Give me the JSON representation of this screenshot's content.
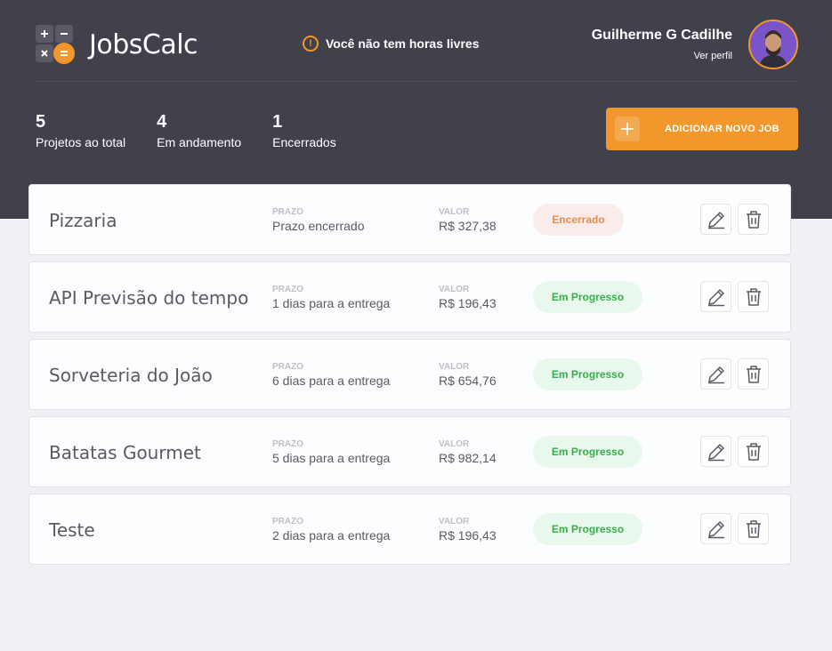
{
  "app": {
    "name": "JobsCalc"
  },
  "alert": {
    "text": "Você não tem horas livres"
  },
  "profile": {
    "name": "Guilherme G Cadilhe",
    "link": "Ver perfil"
  },
  "stats": [
    {
      "number": "5",
      "label": "Projetos ao total"
    },
    {
      "number": "4",
      "label": "Em andamento"
    },
    {
      "number": "1",
      "label": "Encerrados"
    }
  ],
  "add_button": {
    "label": "ADICIONAR NOVO JOB"
  },
  "columns": {
    "deadline_label": "PRAZO",
    "value_label": "VALOR"
  },
  "colors": {
    "accent": "#F1972C",
    "header": "#41414C",
    "done_bg": "#FAECEB",
    "done_fg": "#EB8C4A",
    "progress_bg": "#E8F8EC",
    "progress_fg": "#36B04A"
  },
  "jobs": [
    {
      "name": "Pizzaria",
      "deadline": "Prazo encerrado",
      "value": "R$ 327,38",
      "status": "Encerrado",
      "status_type": "done"
    },
    {
      "name": "API Previsão do tempo",
      "deadline": "1 dias para a entrega",
      "value": "R$ 196,43",
      "status": "Em Progresso",
      "status_type": "progress"
    },
    {
      "name": "Sorveteria do João",
      "deadline": "6 dias para a entrega",
      "value": "R$ 654,76",
      "status": "Em Progresso",
      "status_type": "progress"
    },
    {
      "name": "Batatas Gourmet",
      "deadline": "5 dias para a entrega",
      "value": "R$ 982,14",
      "status": "Em Progresso",
      "status_type": "progress"
    },
    {
      "name": "Teste",
      "deadline": "2 dias para a entrega",
      "value": "R$ 196,43",
      "status": "Em Progresso",
      "status_type": "progress"
    }
  ]
}
